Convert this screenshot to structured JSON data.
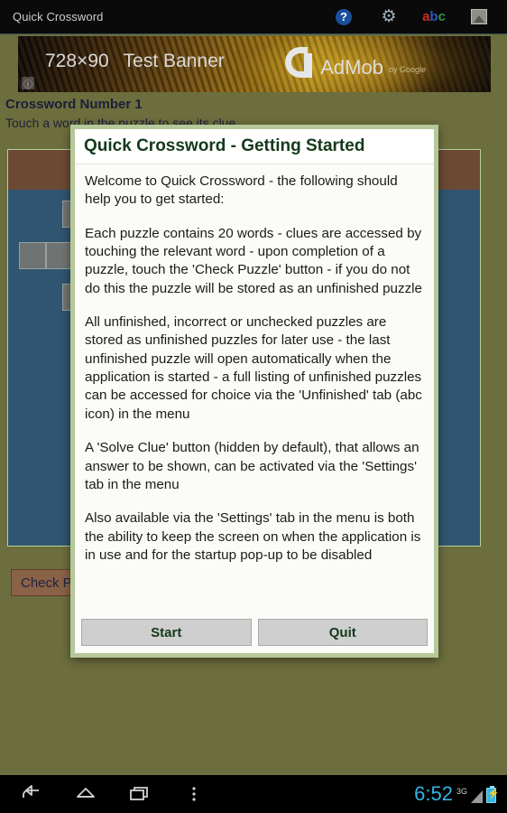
{
  "actionbar": {
    "app_title": "Quick Crossword",
    "icons": [
      {
        "name": "help-icon",
        "glyph": "?"
      },
      {
        "name": "settings-gear-icon",
        "glyph": "⚙"
      },
      {
        "name": "unfinished-abc-icon",
        "a": "a",
        "b": "b",
        "c": "c"
      },
      {
        "name": "picture-icon"
      }
    ]
  },
  "ad": {
    "size_label": "728×90",
    "banner_label": "Test Banner",
    "brand": "AdMob",
    "brand_by": "by Google",
    "info_glyph": "ⓘ"
  },
  "page": {
    "heading": "Crossword Number 1",
    "subheading": "Touch a word in the puzzle to see its clue",
    "check_button": "Check Puzzle"
  },
  "dialog": {
    "title": "Quick Crossword - Getting Started",
    "paragraphs": [
      "Welcome to Quick Crossword - the following should help you to get started:",
      "Each puzzle contains 20 words - clues are accessed by touching the relevant word - upon completion of a puzzle, touch the 'Check Puzzle' button - if you do not do this the puzzle will be stored as an unfinished puzzle",
      "All unfinished, incorrect or unchecked puzzles are stored as unfinished puzzles for later use - the last unfinished puzzle will open automatically when the application is started - a full listing of unfinished puzzles can be accessed for choice via the 'Unfinished' tab (abc icon) in the menu",
      "A 'Solve Clue' button (hidden by default), that allows an answer to be shown, can be activated via the 'Settings' tab in the menu",
      "Also available via the 'Settings' tab in the menu is both the ability to keep the screen on when the application is in use and for the startup pop-up to be disabled"
    ],
    "start_label": "Start",
    "quit_label": "Quit"
  },
  "navbar": {
    "back": "back-icon",
    "home": "home-icon",
    "recents": "recent-apps-icon",
    "menu": "overflow-menu-icon",
    "clock": "6:52",
    "network": "3G"
  },
  "colors": {
    "app_background": "#6d6e3d",
    "dialog_frame": "#b5c89a",
    "dialog_surface": "#fbfbf7",
    "title_text": "#14391a",
    "grid_blue": "#2f5570",
    "grid_header_brown": "#6b4a33",
    "cell_gray": "#6f7472",
    "check_button": "#8a6248",
    "clock_blue": "#33b5e5"
  }
}
